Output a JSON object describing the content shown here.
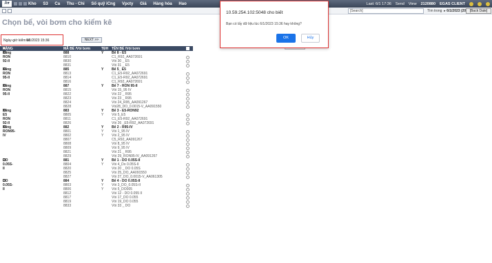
{
  "header": {
    "menu": [
      "Kho",
      "S3",
      "Ca",
      "Thu - Chi",
      "Số quỹ iCng",
      "Vpcty",
      "Giá",
      "Hàng hóa",
      "Hao"
    ],
    "right": {
      "last": "Last: 6/1 17:36",
      "send": "Send",
      "view": "View",
      "user_code": "2120880",
      "client": "EGAS CLIENT"
    }
  },
  "toolbar": {
    "search_placeholder": "[Search]",
    "search_option": "Tìm trong",
    "date_label": "6/1/2023 (2023)",
    "back_button": "[Back Date]"
  },
  "page": {
    "title": "Chọn bể, vòi bơm cho kiểm kê"
  },
  "filter": {
    "label": "Ngày-giờ kiểm kê",
    "datetime": "6/1/2023 15:36",
    "next_button": "NEXT >>"
  },
  "table": {
    "columns": [
      "HÀNG HÓA",
      "MÃ BỂ /Vòi bơm",
      "TĐH",
      "TÊN BỂ /Vòi bơm"
    ],
    "rows": [
      {
        "product": "Xăng RON 92-II",
        "code": "888",
        "tdh": "Y",
        "name": "Bể 8 - E5",
        "first": true
      },
      {
        "product": "",
        "code": "8810",
        "tdh": "",
        "name": "C1_R92_AA072691"
      },
      {
        "product": "",
        "code": "8830",
        "tdh": "",
        "name": "Vòi 30 _ E5"
      },
      {
        "product": "",
        "code": "8831",
        "tdh": "",
        "name": "Vòi 31 _ E5"
      },
      {
        "product": "Xăng RON 95-II",
        "code": "885",
        "tdh": "Y",
        "name": "Bể 5_ E5",
        "first": true
      },
      {
        "product": "",
        "code": "8813",
        "tdh": "",
        "name": "C1_E5-R92_AA072691"
      },
      {
        "product": "",
        "code": "8814",
        "tdh": "",
        "name": "C1_E5-R92_AA072691"
      },
      {
        "product": "",
        "code": "8816",
        "tdh": "",
        "name": "C1_R92_AA072691"
      },
      {
        "product": "Xăng RON 95-II",
        "code": "887",
        "tdh": "Y",
        "name": "Bể 7 - RON 95-II",
        "first": true
      },
      {
        "product": "",
        "code": "8815",
        "tdh": "",
        "name": "Vòi 15_95 IV"
      },
      {
        "product": "",
        "code": "8822",
        "tdh": "",
        "name": "Vòi 22 _ R95"
      },
      {
        "product": "",
        "code": "8823",
        "tdh": "",
        "name": "Vòi 23 _ R95"
      },
      {
        "product": "",
        "code": "8824",
        "tdh": "",
        "name": "Vòi 24_R95_AA091267"
      },
      {
        "product": "",
        "code": "8828",
        "tdh": "",
        "name": "Vòi28_DO_0.0015-V_AA091550"
      },
      {
        "product": "Xăng E5 RON 92-II",
        "code": "883",
        "tdh": "Y",
        "name": "Bể 3 - E5-RON92",
        "first": true
      },
      {
        "product": "",
        "code": "8805",
        "tdh": "Y",
        "name": "Vòi 5_E5"
      },
      {
        "product": "",
        "code": "8811",
        "tdh": "",
        "name": "C1_E5-R92_AA072691"
      },
      {
        "product": "",
        "code": "8826",
        "tdh": "",
        "name": "Vòi 26 _E5-R92_AA072691"
      },
      {
        "product": "Xăng RON95-IV",
        "code": "882",
        "tdh": "Y",
        "name": "Bể 2 - R95-IV",
        "first": true
      },
      {
        "product": "",
        "code": "8801",
        "tdh": "Y",
        "name": "Vòi 1_95 IV"
      },
      {
        "product": "",
        "code": "8802",
        "tdh": "Y",
        "name": "Vòi 2_95 IV"
      },
      {
        "product": "",
        "code": "8807",
        "tdh": "",
        "name": "C5_R92_AA091267"
      },
      {
        "product": "",
        "code": "8808",
        "tdh": "",
        "name": "Vòi 8_95 IV"
      },
      {
        "product": "",
        "code": "8809",
        "tdh": "",
        "name": "Vòi 9_95 IV"
      },
      {
        "product": "",
        "code": "8821",
        "tdh": "",
        "name": "Vòi 21 _ R95"
      },
      {
        "product": "",
        "code": "8829",
        "tdh": "",
        "name": "Vòi 29_RON95-IV_AA091267"
      },
      {
        "product": "DO 0.05S-II",
        "code": "881",
        "tdh": "Y",
        "name": "Bể 1 - DO 0.05S-II",
        "first": true
      },
      {
        "product": "",
        "code": "8804",
        "tdh": "Y",
        "name": "Vòi 4_Do 0.05S-II"
      },
      {
        "product": "",
        "code": "8820",
        "tdh": "",
        "name": "Vòi 20 _ DO 0.05S"
      },
      {
        "product": "",
        "code": "8825",
        "tdh": "",
        "name": "Vòi 25_DO_AA091550"
      },
      {
        "product": "",
        "code": "8827",
        "tdh": "",
        "name": "Vòi 27_DO_0.0015-V_AA061305"
      },
      {
        "product": "DO 0.05S-II",
        "code": "884",
        "tdh": "Y",
        "name": "Bể 4 - DO 0.05S-II",
        "first": true
      },
      {
        "product": "",
        "code": "8803",
        "tdh": "Y",
        "name": "Vòi 3_DO_0.05S-II"
      },
      {
        "product": "",
        "code": "8806",
        "tdh": "Y",
        "name": "Vòi 5_DO005"
      },
      {
        "product": "",
        "code": "8812",
        "tdh": "",
        "name": "Vòi 12 - DO 0.055 II"
      },
      {
        "product": "",
        "code": "8817",
        "tdh": "",
        "name": "Vòi 17_DO 0.055"
      },
      {
        "product": "",
        "code": "8819",
        "tdh": "",
        "name": "Vòi 19_DO 0.055"
      },
      {
        "product": "",
        "code": "8833",
        "tdh": "",
        "name": "Vòi 33 _ DO"
      }
    ]
  },
  "dialog": {
    "title": "10.59.254.102:5048 cho biết",
    "message": "Bạn có lấy dữ liệu lúc 6/1/2023 15:36 hay không?",
    "ok": "OK",
    "cancel": "Hủy"
  },
  "colors": {
    "header_bg": "#3a4558",
    "table_header_bg": "#3b4a63",
    "accent_blue": "#1a73e8",
    "highlight_red": "#dd3333"
  }
}
